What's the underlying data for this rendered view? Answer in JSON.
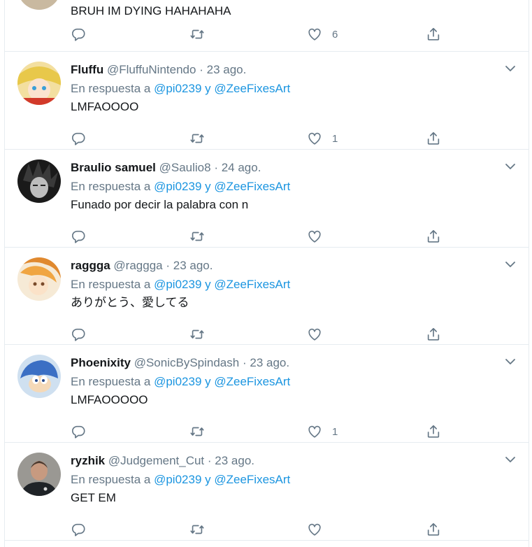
{
  "top_tweet": {
    "text": "BRUH IM DYING HAHAHAHA",
    "like_count": "6"
  },
  "tweets": [
    {
      "name": "Fluffu",
      "handle": "@FluffuNintendo",
      "dot": "·",
      "date": "23 ago.",
      "reply_prefix": "En respuesta a",
      "mention1": "@pi0239",
      "reply_and": "y",
      "mention2": "@ZeeFixesArt",
      "text": "LMFAOOOO",
      "like_count": "1"
    },
    {
      "name": "Braulio samuel",
      "handle": "@Saulio8",
      "dot": "·",
      "date": "24 ago.",
      "reply_prefix": "En respuesta a",
      "mention1": "@pi0239",
      "reply_and": "y",
      "mention2": "@ZeeFixesArt",
      "text": "Funado por decir la palabra con n",
      "like_count": ""
    },
    {
      "name": "raggga",
      "handle": "@raggga",
      "dot": "·",
      "date": "23 ago.",
      "reply_prefix": "En respuesta a",
      "mention1": "@pi0239",
      "reply_and": "y",
      "mention2": "@ZeeFixesArt",
      "text": "ありがとう、愛してる",
      "like_count": ""
    },
    {
      "name": "Phoenixity",
      "handle": "@SonicBySpindash",
      "dot": "·",
      "date": "23 ago.",
      "reply_prefix": "En respuesta a",
      "mention1": "@pi0239",
      "reply_and": "y",
      "mention2": "@ZeeFixesArt",
      "text": "LMFAOOOOO",
      "like_count": "1"
    },
    {
      "name": "ryzhik",
      "handle": "@Judgement_Cut",
      "dot": "·",
      "date": "23 ago.",
      "reply_prefix": "En respuesta a",
      "mention1": "@pi0239",
      "reply_and": "y",
      "mention2": "@ZeeFixesArt",
      "text": "GET EM",
      "like_count": ""
    }
  ],
  "colors": {
    "link": "#1b95e0",
    "muted": "#657786",
    "text": "#14171a",
    "divider": "#e6ecf0"
  },
  "icons": [
    "reply-icon",
    "retweet-icon",
    "like-icon",
    "share-icon",
    "chevron-down-icon"
  ]
}
